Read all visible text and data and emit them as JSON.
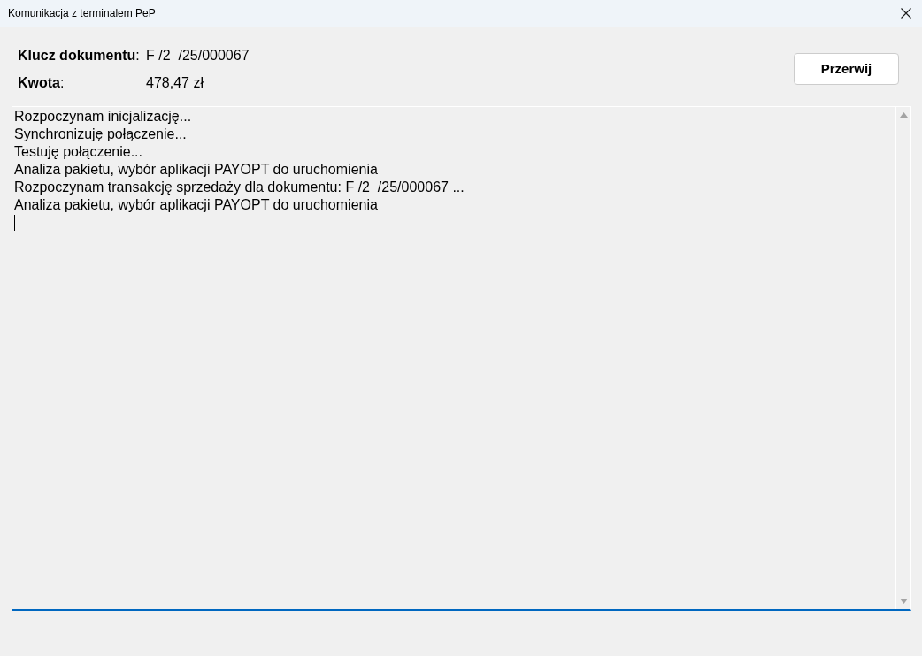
{
  "window": {
    "title": "Komunikacja z terminalem PeP"
  },
  "document_key": {
    "label": "**Klucz dokumentu**:",
    "value": "F /2  /25/000067"
  },
  "amount": {
    "label": "**Kwota**:",
    "value": "478,47 zł"
  },
  "buttons": [
    {
      "label": "Przerwij"
    }
  ],
  "log": {
    "focused": true,
    "lines": [
      "Rozpoczynam inicjalizację...",
      "Synchronizuję połączenie...",
      "Testuję połączenie...",
      "Analiza pakietu, wybór aplikacji PAYOPT do uruchomienia",
      "Rozpoczynam transakcję sprzedaży dla dokumentu: F /2  /25/000067 ...",
      "Analiza pakietu, wybór aplikacji PAYOPT do uruchomienia"
    ]
  }
}
